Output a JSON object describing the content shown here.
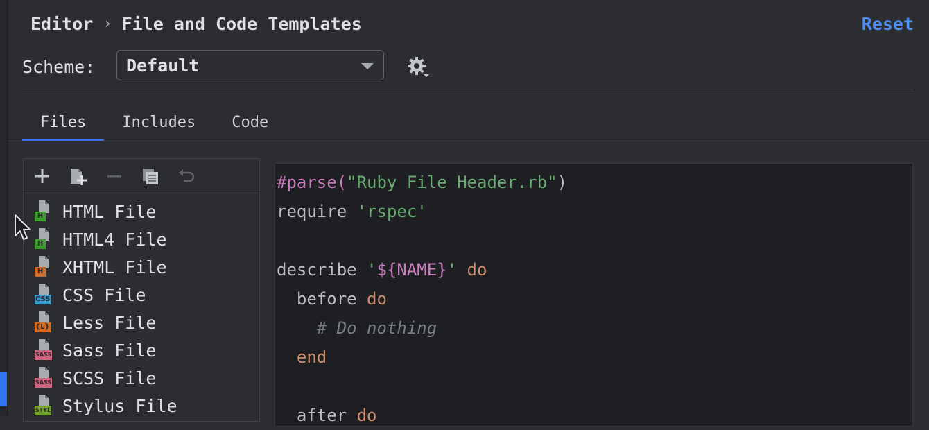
{
  "breadcrumb": {
    "parent": "Editor",
    "separator": "›",
    "current": "File and Code Templates"
  },
  "reset_label": "Reset",
  "scheme": {
    "label": "Scheme:",
    "value": "Default"
  },
  "tabs": [
    {
      "label": "Files",
      "active": true
    },
    {
      "label": "Includes",
      "active": false
    },
    {
      "label": "Code",
      "active": false
    }
  ],
  "toolbar": {
    "icons": [
      "add-icon",
      "add-child-icon",
      "remove-icon",
      "copy-icon",
      "undo-icon"
    ]
  },
  "files": [
    {
      "label": "HTML File",
      "badge": "H",
      "badge_color": "#3f9d30"
    },
    {
      "label": "HTML4 File",
      "badge": "H",
      "badge_color": "#3f9d30"
    },
    {
      "label": "XHTML File",
      "badge": "H",
      "badge_color": "#d26a25"
    },
    {
      "label": "CSS File",
      "badge": "CSS",
      "badge_color": "#3a98c9"
    },
    {
      "label": "Less File",
      "badge": "{L}",
      "badge_color": "#d26a25"
    },
    {
      "label": "Sass File",
      "badge": "SASS",
      "badge_color": "#d1617c"
    },
    {
      "label": "SCSS File",
      "badge": "SASS",
      "badge_color": "#d1617c"
    },
    {
      "label": "Stylus File",
      "badge": "STYL",
      "badge_color": "#74a02e"
    }
  ],
  "code": {
    "l1_dir": "#parse(",
    "l1_str": "\"Ruby File Header.rb\"",
    "l1_end": ")",
    "l2_kw": "require ",
    "l2_str": "'rspec'",
    "l4_kw": "describe ",
    "l4_q1": "'",
    "l4_var": "${NAME}",
    "l4_q2": "'",
    "l4_do": " do",
    "l5_kw": "  before ",
    "l5_do": "do",
    "l6_cmt": "    # Do nothing",
    "l7_end": "  end",
    "l9_kw": "  after ",
    "l9_do": "do"
  },
  "colors": {
    "accent": "#3574f0",
    "link": "#4c8df6",
    "background": "#2b2d30",
    "editor_background": "#1e1f22"
  }
}
